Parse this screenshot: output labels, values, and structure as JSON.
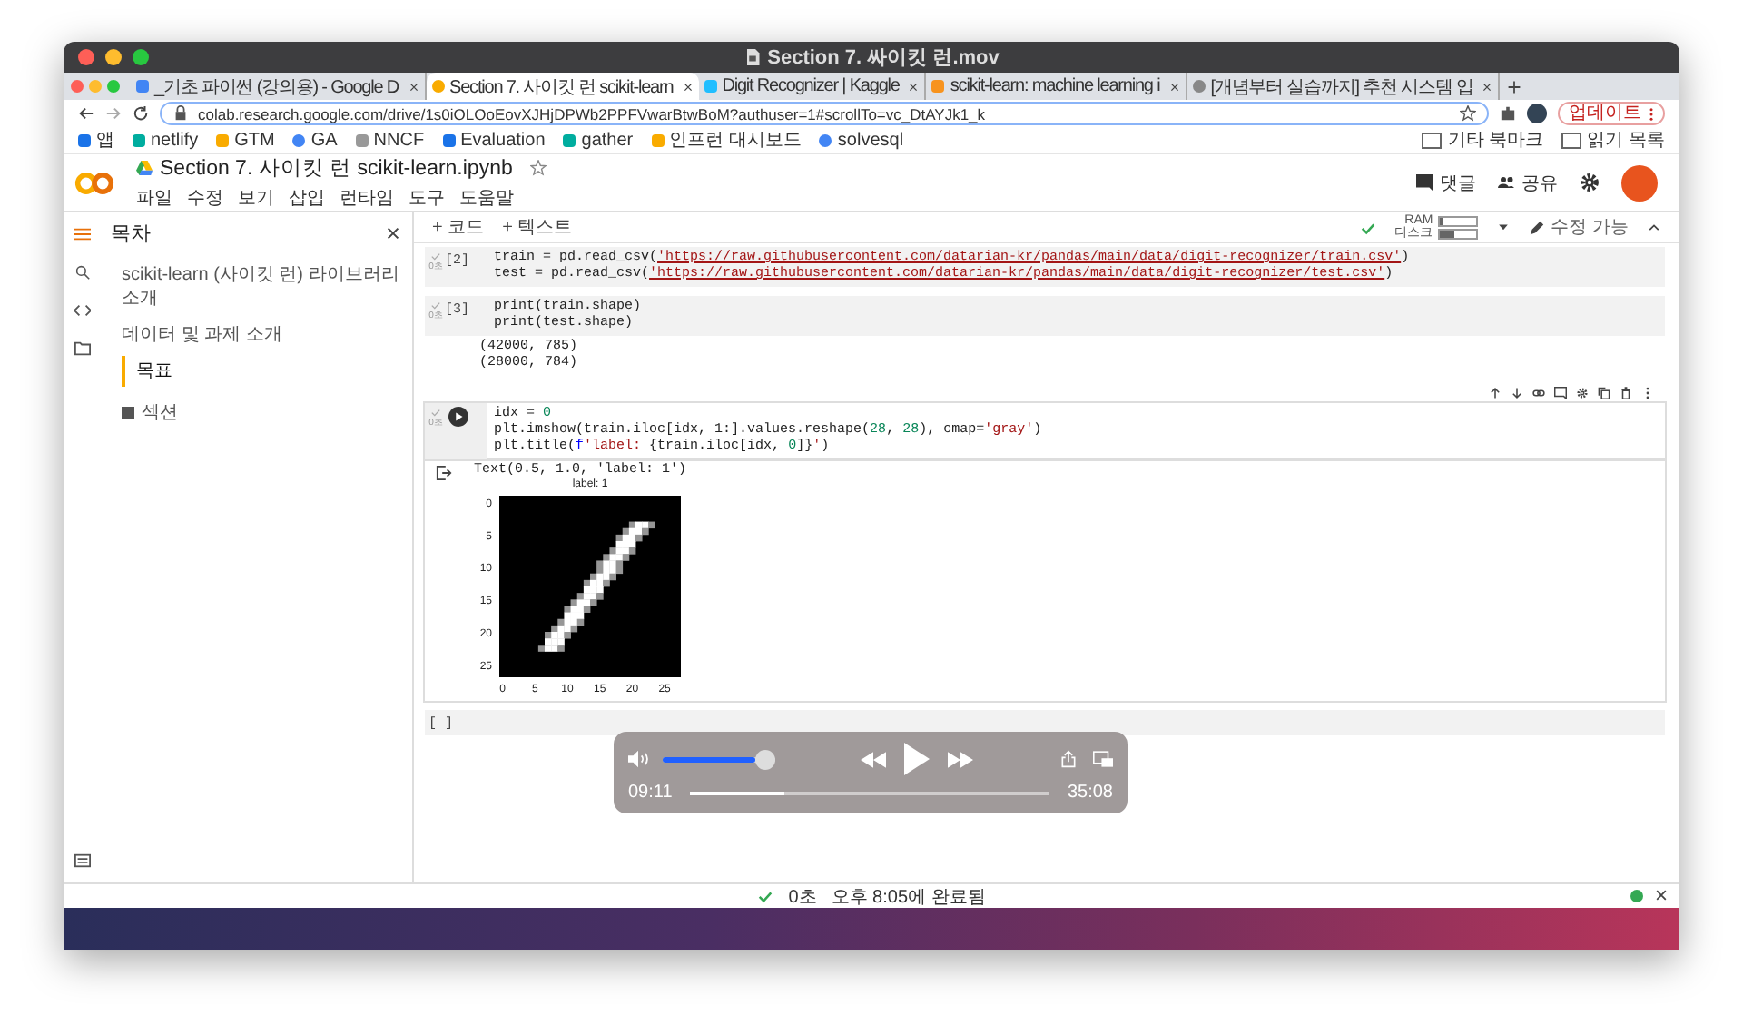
{
  "window": {
    "title": "Section 7. 싸이킷 런.mov"
  },
  "browser": {
    "tabs": [
      {
        "title": "_기초 파이썬 (강의용) - Google D",
        "selected": false
      },
      {
        "title": "Section 7. 사이킷 런 scikit-learn",
        "selected": true
      },
      {
        "title": "Digit Recognizer | Kaggle",
        "selected": false
      },
      {
        "title": "scikit-learn: machine learning i",
        "selected": false
      },
      {
        "title": "[개념부터 실습까지] 추천 시스템 입",
        "selected": false
      }
    ],
    "url": "colab.research.google.com/drive/1s0iOLOoEovXJHjDPWb2PPFVwarBtwBoM?authuser=1#scrollTo=vc_DtAYJk1_k",
    "update_button": "업데이트",
    "bookmarks": [
      "앱",
      "netlify",
      "GTM",
      "GA",
      "NNCF",
      "Evaluation",
      "gather",
      "인프런 대시보드",
      "solvesql"
    ],
    "bookmarks_right": [
      "기타 북마크",
      "읽기 목록"
    ]
  },
  "notebook": {
    "title": "Section 7. 사이킷 런 scikit-learn.ipynb",
    "menu": [
      "파일",
      "수정",
      "보기",
      "삽입",
      "런타임",
      "도구",
      "도움말"
    ],
    "comment_button": "댓글",
    "share_button": "공유",
    "toolbar": {
      "add_code": "+ 코드",
      "add_text": "+ 텍스트",
      "ram_label": "RAM",
      "ram": {
        "level": 0.1
      },
      "disk_label": "디스크",
      "disk": {
        "level": 0.4
      },
      "edit_mode": "수정 가능"
    }
  },
  "sidebar": {
    "title": "목차",
    "items": [
      {
        "label": "scikit-learn (사이킷 런) 라이브러리 소개",
        "selected": false
      },
      {
        "label": "데이터 및 과제 소개",
        "selected": false,
        "children": [
          {
            "label": "목표",
            "selected": true
          }
        ]
      }
    ],
    "section_button": "섹션"
  },
  "cells": [
    {
      "kind": "code",
      "active": false,
      "count": "[2]",
      "time": "0초",
      "lines": [
        [
          {
            "text": "train = pd.read_csv(",
            "kind": "plain"
          },
          {
            "text": "'https://raw.githubusercontent.com/datarian-kr/pandas/main/data/digit-recognizer/train.csv'",
            "kind": "url"
          },
          {
            "text": ")",
            "kind": "plain"
          }
        ],
        [
          {
            "text": "test = pd.read_csv(",
            "kind": "plain"
          },
          {
            "text": "'https://raw.githubusercontent.com/datarian-kr/pandas/main/data/digit-recognizer/test.csv'",
            "kind": "url"
          },
          {
            "text": ")",
            "kind": "plain"
          }
        ]
      ]
    },
    {
      "kind": "code",
      "active": false,
      "count": "[3]",
      "time": "0초",
      "lines": [
        [
          {
            "text": "print(train.shape)",
            "kind": "plain"
          }
        ],
        [
          {
            "text": "print(test.shape)",
            "kind": "plain"
          }
        ]
      ],
      "output": {
        "lines": [
          "(42000, 785)",
          "(28000, 784)"
        ]
      }
    },
    {
      "kind": "code",
      "active": true,
      "time": "0초",
      "lines": [
        [
          {
            "text": "idx = ",
            "kind": "plain"
          },
          {
            "text": "0",
            "kind": "number"
          }
        ],
        [
          {
            "text": "plt.imshow(train.iloc[idx, 1:].values.reshape(",
            "kind": "plain"
          },
          {
            "text": "28",
            "kind": "number"
          },
          {
            "text": ", ",
            "kind": "plain"
          },
          {
            "text": "28",
            "kind": "number"
          },
          {
            "text": "), cmap=",
            "kind": "plain"
          },
          {
            "text": "'gray'",
            "kind": "string"
          },
          {
            "text": ")",
            "kind": "plain"
          }
        ],
        [
          {
            "text": "plt.title(",
            "kind": "plain"
          },
          {
            "text": "f",
            "kind": "keyword"
          },
          {
            "text": "'label: ",
            "kind": "string"
          },
          {
            "text": "{train.iloc[idx, ",
            "kind": "plain"
          },
          {
            "text": "0",
            "kind": "number"
          },
          {
            "text": "]}",
            "kind": "plain"
          },
          {
            "text": "'",
            "kind": "string"
          },
          {
            "text": ")",
            "kind": "plain"
          }
        ]
      ],
      "output": {
        "lines": [
          "Text(0.5, 1.0, 'label: 1')"
        ],
        "plot": {
          "title": "label: 1",
          "yticks": [
            "0",
            "5",
            "10",
            "15",
            "20",
            "25"
          ],
          "xticks": [
            "0",
            "5",
            "10",
            "15",
            "20",
            "25"
          ]
        }
      }
    },
    {
      "kind": "code",
      "active": false,
      "count": "[ ]"
    }
  ],
  "video": {
    "volume": {
      "level": 0.82
    },
    "progress": {
      "level": 0.262
    },
    "elapsed": "09:11",
    "total": "35:08"
  },
  "status_bar": {
    "time": "0초",
    "message": "오후 8:05에 완료됨"
  }
}
